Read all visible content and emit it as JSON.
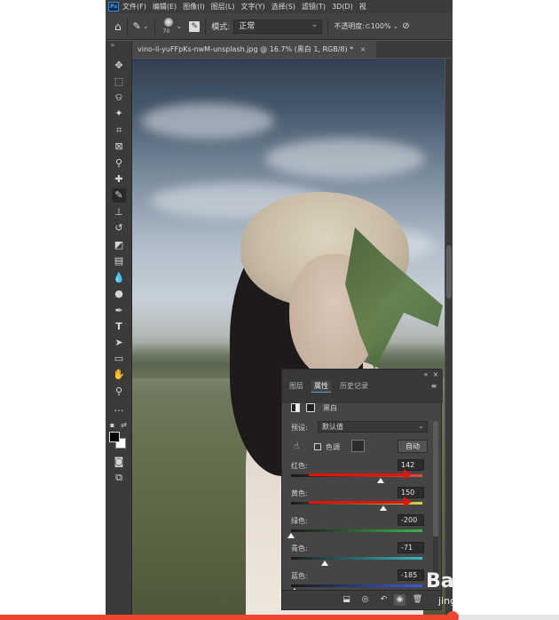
{
  "menubar": {
    "items": [
      "文件(F)",
      "编辑(E)",
      "图像(I)",
      "图层(L)",
      "文字(Y)",
      "选择(S)",
      "滤镜(T)",
      "3D(D)",
      "视"
    ]
  },
  "options_bar": {
    "brush_size": "70",
    "mode_label": "模式:",
    "mode_value": "正常",
    "opacity_label": "不透明度:",
    "opacity_value": "100%"
  },
  "document": {
    "tab_title": "vino-li-yuFFpKs-nwM-unsplash.jpg @ 16.7% (黑白 1, RGB/8) *",
    "close_symbol": "×"
  },
  "tools": [
    "move-tool",
    "marquee-tool",
    "lasso-tool",
    "magic-wand-tool",
    "crop-tool",
    "frame-tool",
    "eyedropper-tool",
    "healing-brush-tool",
    "brush-tool",
    "clone-stamp-tool",
    "history-brush-tool",
    "eraser-tool",
    "gradient-tool",
    "blur-tool",
    "dodge-tool",
    "pen-tool",
    "type-tool",
    "path-selection-tool",
    "shape-tool",
    "hand-tool",
    "zoom-tool",
    "more-tools"
  ],
  "properties_panel": {
    "tabs": [
      "图层",
      "属性",
      "历史记录"
    ],
    "active_tab": "属性",
    "adjustment_name": "黑白",
    "preset_label": "预设:",
    "preset_value": "默认值",
    "tint_label": "色调",
    "tint_checked": false,
    "auto_button": "自动",
    "sliders": [
      {
        "label": "红色:",
        "value": "142",
        "min": -200,
        "max": 300,
        "track_color": "#e34a3c"
      },
      {
        "label": "黄色:",
        "value": "150",
        "min": -200,
        "max": 300,
        "track_color": "#d9d24a"
      },
      {
        "label": "绿色:",
        "value": "-200",
        "min": -200,
        "max": 300,
        "track_color": "#3bb44a"
      },
      {
        "label": "青色:",
        "value": "-71",
        "min": -200,
        "max": 300,
        "track_color": "#3ab9c4"
      },
      {
        "label": "蓝色:",
        "value": "-185",
        "min": -200,
        "max": 300,
        "track_color": "#3a5ad9"
      }
    ]
  },
  "viewer": {
    "next_symbol": "›",
    "watermark_main": "Bai 经验",
    "watermark_sub": "jingyan.baidu.com",
    "progress": 0.81
  },
  "colors": {
    "annotation_arrow": "#e0140f",
    "progress": "#f0452d",
    "ps_panel": "#454545"
  }
}
